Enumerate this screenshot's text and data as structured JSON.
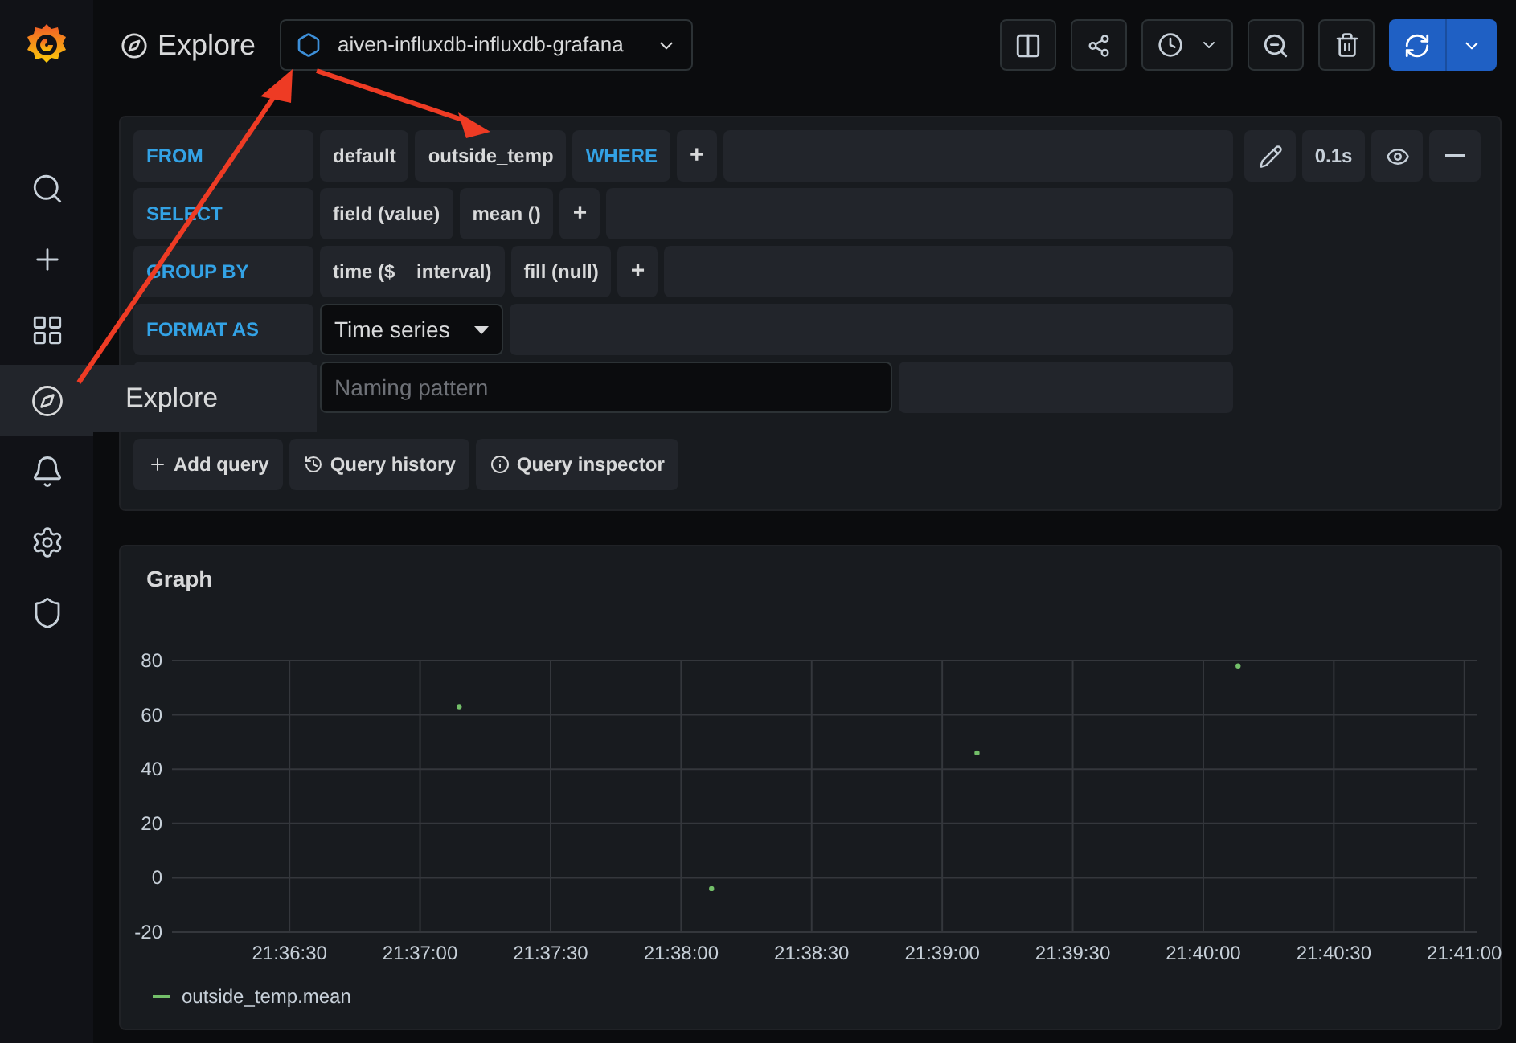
{
  "sidebar": {
    "items": [
      {
        "kind": "search",
        "selected": false
      },
      {
        "kind": "plus",
        "selected": false
      },
      {
        "kind": "grid",
        "selected": false
      },
      {
        "kind": "explore",
        "selected": true,
        "tooltip": "Explore"
      },
      {
        "kind": "bell",
        "selected": false
      },
      {
        "kind": "gear",
        "selected": false
      },
      {
        "kind": "shield",
        "selected": false
      }
    ]
  },
  "header": {
    "title": "Explore",
    "datasource": "aiven-influxdb-influxdb-grafana"
  },
  "query": {
    "rows": [
      {
        "kind": "segments",
        "label": "FROM",
        "segments": [
          {
            "kind": "value",
            "text": "default"
          },
          {
            "kind": "value",
            "text": "outside_temp"
          },
          {
            "kind": "keyword",
            "text": "WHERE"
          },
          {
            "kind": "add",
            "text": "+"
          }
        ]
      },
      {
        "kind": "segments",
        "label": "SELECT",
        "segments": [
          {
            "kind": "value",
            "text": "field (value)"
          },
          {
            "kind": "value",
            "text": "mean ()"
          },
          {
            "kind": "add",
            "text": "+"
          }
        ]
      },
      {
        "kind": "segments",
        "label": "GROUP BY",
        "segments": [
          {
            "kind": "value",
            "text": "time ($__interval)"
          },
          {
            "kind": "value",
            "text": "fill (null)"
          },
          {
            "kind": "add",
            "text": "+"
          }
        ]
      },
      {
        "kind": "select",
        "label": "FORMAT AS",
        "value": "Time series"
      },
      {
        "kind": "alias",
        "placeholder": "Naming pattern"
      }
    ],
    "duration": "0.1s",
    "buttons": [
      {
        "kind": "add",
        "label": "Add query"
      },
      {
        "kind": "history",
        "label": "Query history"
      },
      {
        "kind": "inspector",
        "label": "Query inspector"
      }
    ]
  },
  "graph": {
    "title": "Graph",
    "chart_data": {
      "type": "scatter",
      "grid": true,
      "x": [
        77829,
        77887,
        77948,
        78008
      ],
      "series": [
        {
          "name": "outside_temp.mean",
          "color": "#73bf69",
          "values": [
            63,
            -4,
            46,
            78
          ]
        }
      ],
      "xlim": [
        77763,
        78063
      ],
      "ylim": [
        -20,
        80
      ],
      "xticks": [
        {
          "value": 77790,
          "label": "21:36:30"
        },
        {
          "value": 77820,
          "label": "21:37:00"
        },
        {
          "value": 77850,
          "label": "21:37:30"
        },
        {
          "value": 77880,
          "label": "21:38:00"
        },
        {
          "value": 77910,
          "label": "21:38:30"
        },
        {
          "value": 77940,
          "label": "21:39:00"
        },
        {
          "value": 77970,
          "label": "21:39:30"
        },
        {
          "value": 78000,
          "label": "21:40:00"
        },
        {
          "value": 78030,
          "label": "21:40:30"
        },
        {
          "value": 78060,
          "label": "21:41:00"
        }
      ],
      "yticks": [
        80,
        60,
        40,
        20,
        0,
        -20
      ]
    }
  }
}
